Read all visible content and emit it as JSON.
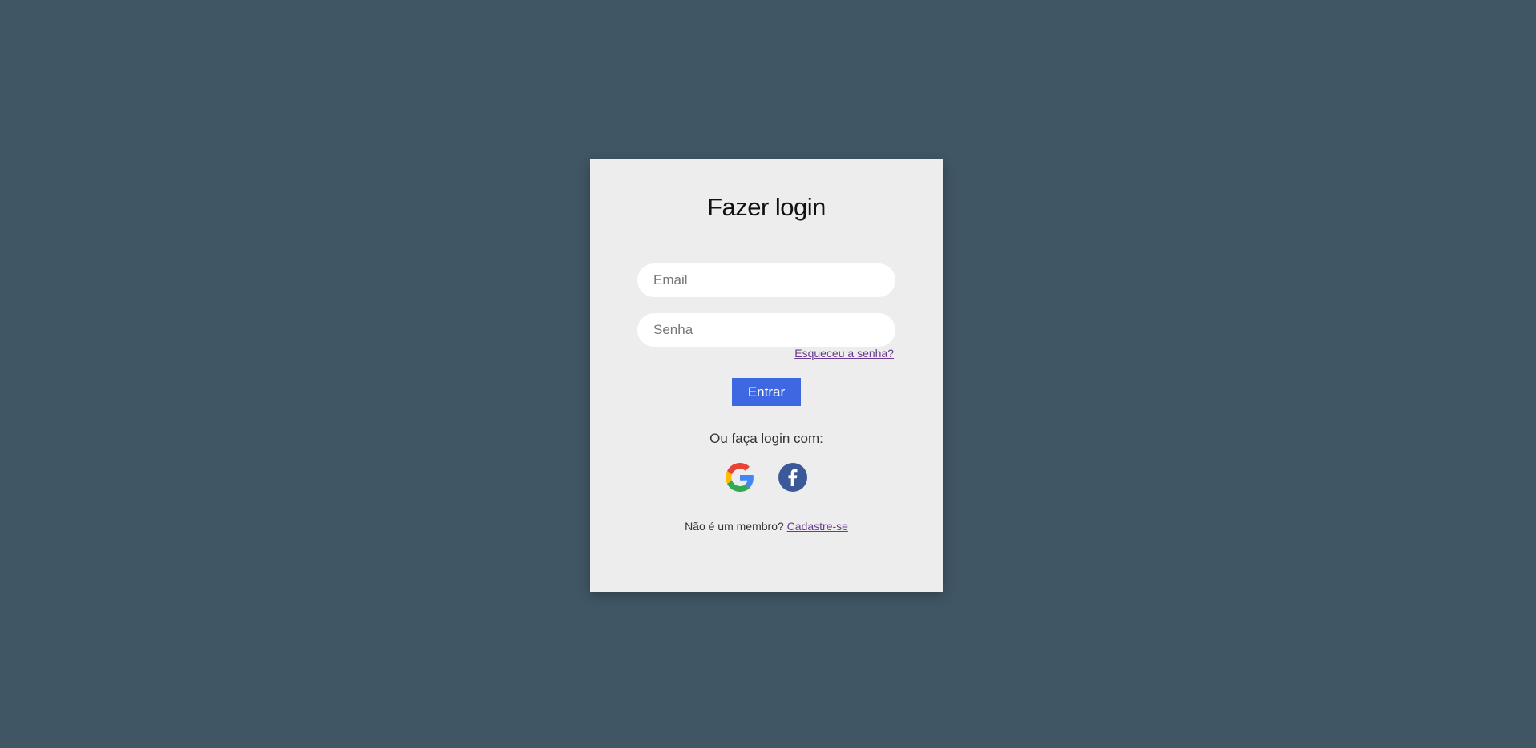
{
  "login": {
    "title": "Fazer login",
    "email_placeholder": "Email",
    "password_placeholder": "Senha",
    "forgot_label": "Esqueceu a senha?",
    "submit_label": "Entrar",
    "alt_login_label": "Ou faça login com:",
    "social": [
      {
        "name": "google-icon"
      },
      {
        "name": "facebook-icon"
      }
    ],
    "not_member_label": "Não é um membro?",
    "signup_label": "Cadastre-se"
  },
  "colors": {
    "background": "#405664",
    "card": "#ededed",
    "button": "#3e68e2",
    "link": "#6a3b8f",
    "facebook": "#3b5998"
  }
}
